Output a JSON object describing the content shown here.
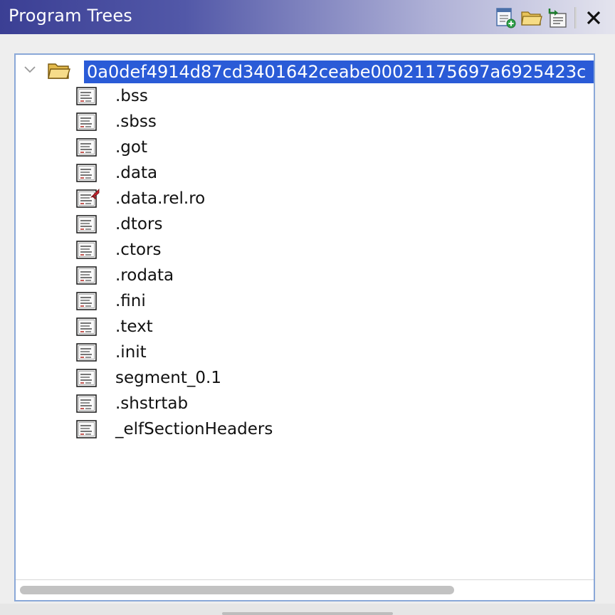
{
  "panel": {
    "title": "Program Trees",
    "accent_color": "#2a5bd7",
    "header_gradient": [
      "#3b3f94",
      "#e4e4ee"
    ],
    "toolbar": [
      {
        "icon": "create-view-icon"
      },
      {
        "icon": "open-tree-icon"
      },
      {
        "icon": "snapshot-icon"
      },
      {
        "icon": "close-icon"
      }
    ]
  },
  "tree": {
    "root": {
      "label": "0a0def4914d87cd3401642ceabe00021175697a6925423c",
      "icon": "folder-open-icon",
      "expanded": true,
      "selected": true
    },
    "children": [
      {
        "label": ".bss",
        "icon": "fragment-icon"
      },
      {
        "label": ".sbss",
        "icon": "fragment-icon"
      },
      {
        "label": ".got",
        "icon": "fragment-icon"
      },
      {
        "label": ".data",
        "icon": "fragment-icon"
      },
      {
        "label": ".data.rel.ro",
        "icon": "fragment-current-icon"
      },
      {
        "label": ".dtors",
        "icon": "fragment-icon"
      },
      {
        "label": ".ctors",
        "icon": "fragment-icon"
      },
      {
        "label": ".rodata",
        "icon": "fragment-icon"
      },
      {
        "label": ".fini",
        "icon": "fragment-icon"
      },
      {
        "label": ".text",
        "icon": "fragment-icon"
      },
      {
        "label": ".init",
        "icon": "fragment-icon"
      },
      {
        "label": "segment_0.1",
        "icon": "fragment-icon"
      },
      {
        "label": ".shstrtab",
        "icon": "fragment-icon"
      },
      {
        "label": "_elfSectionHeaders",
        "icon": "fragment-icon"
      }
    ]
  },
  "scrollbar": {
    "horizontal_position": 0.0
  }
}
